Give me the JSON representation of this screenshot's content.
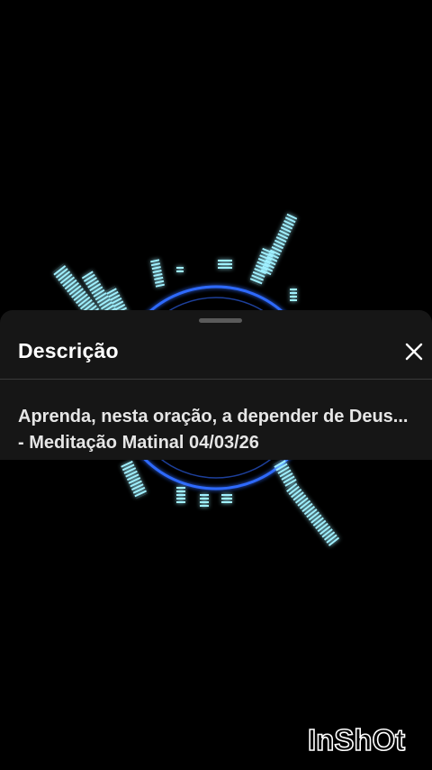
{
  "sheet": {
    "title": "Descrição",
    "description": "Aprenda, nesta oração, a depender de Deus... - Meditação Matinal 04/03/26"
  },
  "watermark": {
    "text": "InShOt"
  },
  "icons": {
    "close": "close-icon"
  },
  "colors": {
    "background": "#000000",
    "sheet": "#161616",
    "accent_cyan": "#7fe3ff",
    "ring_blue": "#3b7bff"
  }
}
